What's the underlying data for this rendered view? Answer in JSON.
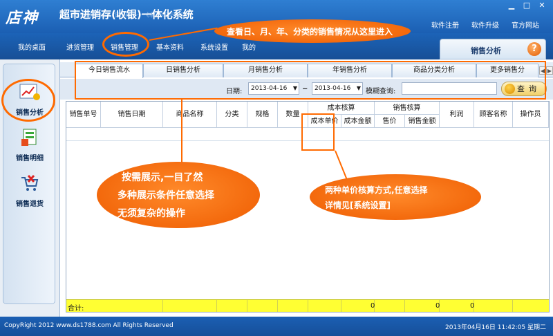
{
  "window": {
    "logo": "店神",
    "title": "超市进销存(收银)一体化系统",
    "controls": [
      "▁",
      "□",
      "✕"
    ],
    "links": [
      "软件注册",
      "软件升级",
      "官方网站"
    ]
  },
  "menu": {
    "items": [
      "我的桌面",
      "进货管理",
      "销售管理",
      "基本资料",
      "系统设置",
      "我的"
    ],
    "panel_title": "销售分析",
    "help": "?"
  },
  "sidebar": {
    "items": [
      "销售分析",
      "销售明细",
      "销售退货"
    ]
  },
  "tabs": [
    "今日销售流水",
    "日销售分析",
    "月销售分析",
    "年销售分析",
    "商品分类分析",
    "更多销售分"
  ],
  "filter": {
    "date_label": "日期:",
    "date_from": "2013-04-16",
    "tilde": "~",
    "date_to": "2013-04-16",
    "fuzzy_label": "模糊查询:",
    "query_button": "查询"
  },
  "table": {
    "columns": [
      "销售单号",
      "销售日期",
      "商品名称",
      "分类",
      "规格",
      "数量",
      "利润",
      "顾客名称",
      "操作员"
    ],
    "cost_group": "成本核算",
    "cost_sub": [
      "成本单价",
      "成本金额"
    ],
    "sales_group": "销售核算",
    "sales_sub": [
      "售价",
      "销售金额"
    ],
    "total_label": "合计:",
    "totals": {
      "cost_amount": "0",
      "sales_amount": "0",
      "profit": "0"
    }
  },
  "annotations": {
    "top": "查看日、月、年、分类的销售情况从这里进入",
    "left_lines": [
      "按需展示,一目了然",
      "多种展示条件任意选择",
      "无须复杂的操作"
    ],
    "right_lines": [
      "两种单价核算方式,任意选择",
      "详情见[系统设置]"
    ]
  },
  "footer": {
    "copyright": "CopyRight  2012   www.ds1788.com   All  Rights  Reserved",
    "datetime": "2013年04月16日  11:42:05  星期二"
  },
  "colors": {
    "accent": "#ff6a00",
    "header": "#1b5fb3",
    "total_row": "#ffff33"
  }
}
